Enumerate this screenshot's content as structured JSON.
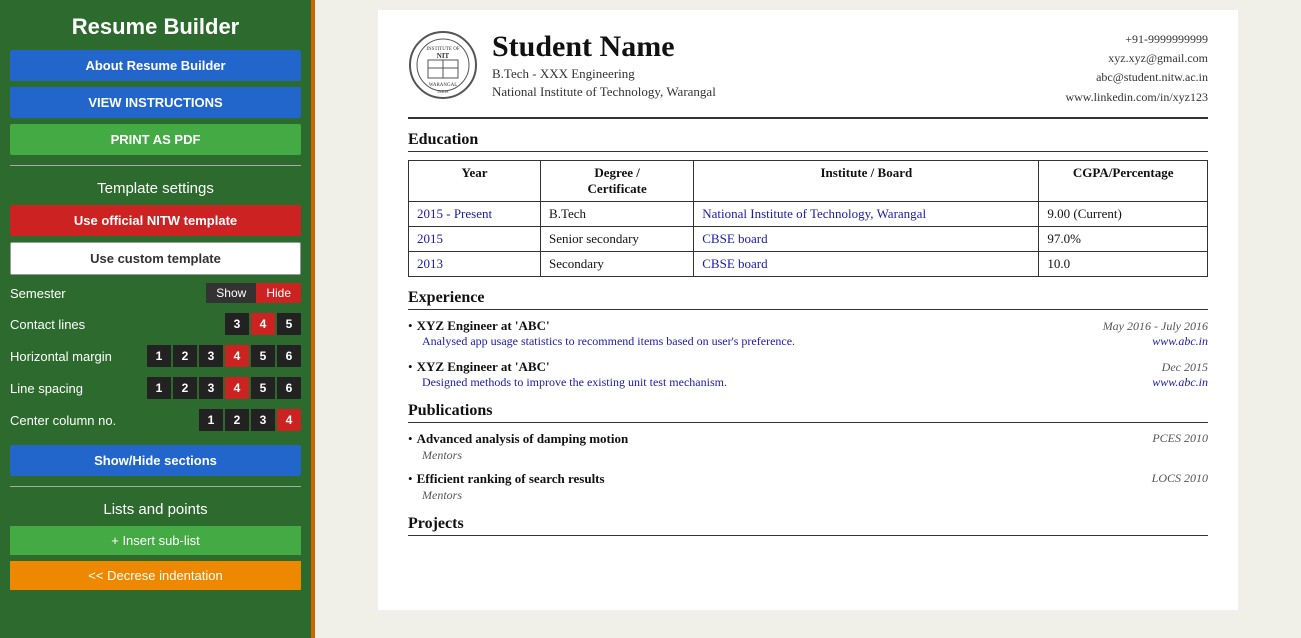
{
  "sidebar": {
    "app_title": "Resume Builder",
    "buttons": {
      "about": "About Resume Builder",
      "view_instructions": "VIEW INSTRUCTIONS",
      "print_pdf": "PRINT AS PDF",
      "use_official": "Use official NITW template",
      "use_custom": "Use custom template",
      "show_hide_sections": "Show/Hide sections",
      "insert_sub_list": "+ Insert sub-list",
      "decrease_indent": "<< Decrese indentation"
    },
    "template_settings_title": "Template settings",
    "lists_and_points_title": "Lists and points",
    "semester": {
      "label": "Semester",
      "show": "Show",
      "hide": "Hide"
    },
    "contact_lines": {
      "label": "Contact lines",
      "options": [
        "3",
        "4",
        "5"
      ],
      "active": "4"
    },
    "horizontal_margin": {
      "label": "Horizontal margin",
      "options": [
        "1",
        "2",
        "3",
        "4",
        "5",
        "6"
      ],
      "active": "4"
    },
    "line_spacing": {
      "label": "Line spacing",
      "options": [
        "1",
        "2",
        "3",
        "4",
        "5",
        "6"
      ],
      "active": "4"
    },
    "center_column_no": {
      "label": "Center column no.",
      "options": [
        "1",
        "2",
        "3",
        "4"
      ],
      "active": "4"
    }
  },
  "resume": {
    "name": "Student Name",
    "degree": "B.Tech - XXX Engineering",
    "institute": "National Institute of Technology, Warangal",
    "contact": {
      "phone": "+91-9999999999",
      "email1": "xyz.xyz@gmail.com",
      "email2": "abc@student.nitw.ac.in",
      "linkedin": "www.linkedin.com/in/xyz123"
    },
    "sections": {
      "education": {
        "title": "Education",
        "headers": [
          "Year",
          "Degree /\nCertificate",
          "Institute / Board",
          "CGPA/Percentage"
        ],
        "rows": [
          {
            "year": "2015 - Present",
            "degree": "B.Tech",
            "institute": "National Institute of Technology, Warangal",
            "cgpa": "9.00 (Current)"
          },
          {
            "year": "2015",
            "degree": "Senior secondary",
            "institute": "CBSE board",
            "cgpa": "97.0%"
          },
          {
            "year": "2013",
            "degree": "Secondary",
            "institute": "CBSE board",
            "cgpa": "10.0"
          }
        ]
      },
      "experience": {
        "title": "Experience",
        "items": [
          {
            "title": "XYZ Engineer at 'ABC'",
            "date": "May 2016 - July 2016",
            "description": "Analysed app usage statistics to recommend items based on user's preference.",
            "link": "www.abc.in"
          },
          {
            "title": "XYZ Engineer at 'ABC'",
            "date": "Dec 2015",
            "description": "Designed methods to improve the existing unit test mechanism.",
            "link": "www.abc.in"
          }
        ]
      },
      "publications": {
        "title": "Publications",
        "items": [
          {
            "title": "Advanced analysis of damping motion",
            "authors": "Mentors",
            "venue": "PCES 2010"
          },
          {
            "title": "Efficient ranking of search results",
            "authors": "Mentors",
            "venue": "LOCS 2010"
          }
        ]
      },
      "projects": {
        "title": "Projects"
      }
    }
  }
}
